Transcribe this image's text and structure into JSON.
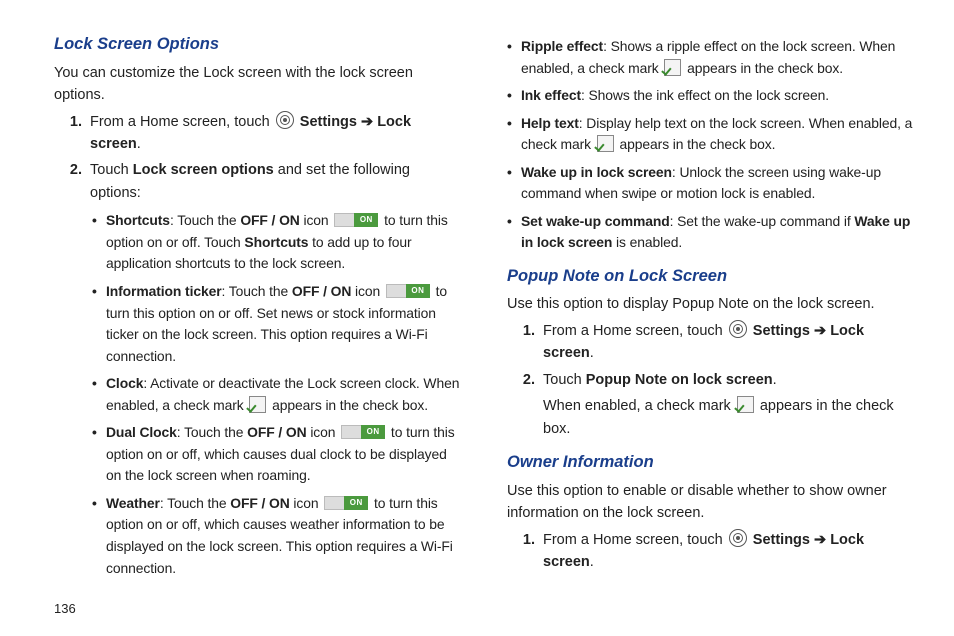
{
  "page_number": "136",
  "arrow": "➔",
  "on_label": "ON",
  "left": {
    "h1": "Lock Screen Options",
    "intro": "You can customize the Lock screen with the lock screen options.",
    "step1_a": "From a Home screen, touch ",
    "step1_b": " Settings ",
    "step1_c": " Lock screen",
    "step2_a": "Touch ",
    "step2_b": "Lock screen options",
    "step2_c": " and set the following options:",
    "bul1_t": "Shortcuts",
    "bul1_a": ": Touch the ",
    "bul1_b": "OFF / ON",
    "bul1_c": " icon ",
    "bul1_d": " to turn this option on or off. Touch ",
    "bul1_e": "Shortcuts",
    "bul1_f": " to add up to four application shortcuts to the lock screen.",
    "bul2_t": "Information ticker",
    "bul2_a": ": Touch the ",
    "bul2_b": "OFF / ON",
    "bul2_c": " icon ",
    "bul2_d": " to turn this option on or off. Set news or stock information ticker on the lock screen. This option requires a Wi-Fi connection.",
    "bul3_t": "Clock",
    "bul3_a": ": Activate or deactivate the Lock screen clock. When enabled, a check mark ",
    "bul3_b": " appears in the check box.",
    "bul4_t": "Dual Clock",
    "bul4_a": ": Touch the ",
    "bul4_b": "OFF / ON",
    "bul4_c": " icon ",
    "bul4_d": " to turn this option on or off, which causes dual clock to be displayed on the lock screen when roaming.",
    "bul5_t": "Weather",
    "bul5_a": ": Touch the ",
    "bul5_b": "OFF / ON",
    "bul5_c": " icon ",
    "bul5_d": " to turn this option on or off, which causes weather information to be displayed on the lock screen. This option requires a Wi-Fi connection."
  },
  "right": {
    "bul6_t": "Ripple effect",
    "bul6_a": ": Shows a ripple effect on the lock screen. When enabled, a check mark ",
    "bul6_b": " appears in the check box.",
    "bul7_t": "Ink effect",
    "bul7_a": ": Shows the ink effect on the lock screen.",
    "bul8_t": "Help text",
    "bul8_a": ": Display help text on the lock screen. When enabled, a check mark ",
    "bul8_b": " appears in the check box.",
    "bul9_t": "Wake up in lock screen",
    "bul9_a": ": Unlock the screen using wake-up command when swipe or motion lock is enabled.",
    "bul10_t": "Set wake-up command",
    "bul10_a": ": Set the wake-up command if ",
    "bul10_b": "Wake up in lock screen",
    "bul10_c": " is enabled.",
    "h2": "Popup Note on Lock Screen",
    "p2": "Use this option to display Popup Note on the lock screen.",
    "s1_a": "From a Home screen, touch ",
    "s1_b": " Settings ",
    "s1_c": " Lock screen",
    "s2_a": "Touch ",
    "s2_b": "Popup Note on lock screen",
    "s2_c": ".",
    "s2_d": "When enabled, a check mark ",
    "s2_e": " appears in the check box.",
    "h3": "Owner Information",
    "p3": "Use this option to enable or disable whether to show owner information on the lock screen.",
    "s3_a": "From a Home screen, touch ",
    "s3_b": " Settings ",
    "s3_c": " Lock screen"
  }
}
